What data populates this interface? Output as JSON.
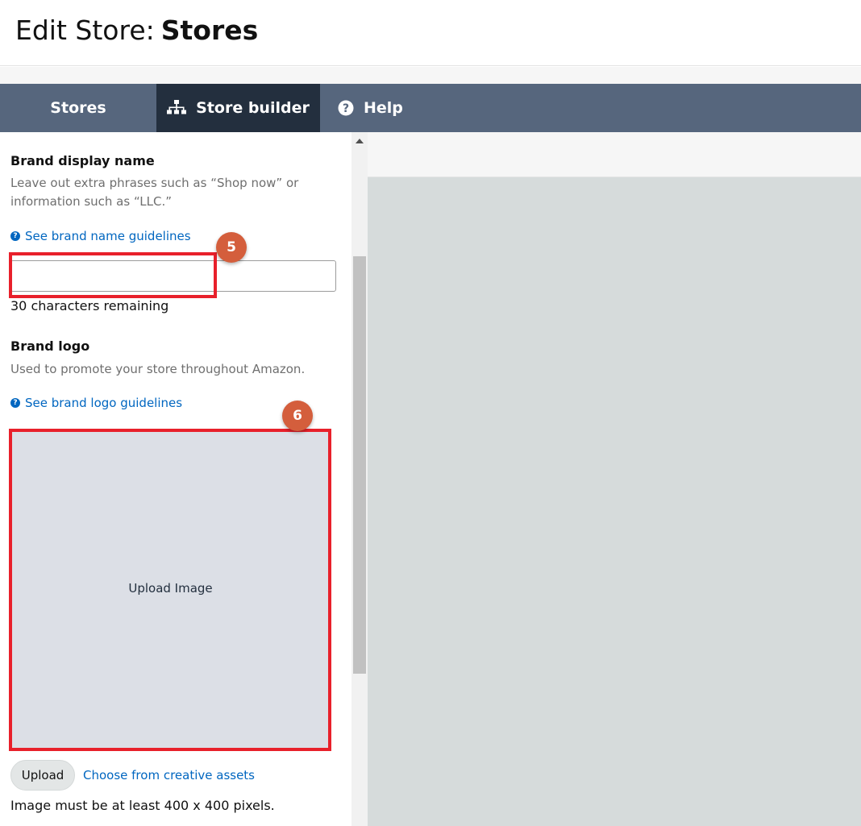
{
  "header": {
    "title_prefix": "Edit Store:",
    "title_store": "Stores"
  },
  "nav": {
    "tabs": [
      {
        "label": "Stores",
        "icon": null,
        "active": false
      },
      {
        "label": "Store builder",
        "icon": "sitemap-icon",
        "active": true
      },
      {
        "label": "Help",
        "icon": "question-circle-icon",
        "active": false
      }
    ]
  },
  "brand_name": {
    "heading": "Brand display name",
    "hint": "Leave out extra phrases such as “Shop now” or information such as “LLC.”",
    "guidelines_link": "See brand name guidelines",
    "input_value": "",
    "input_placeholder": "",
    "chars_remaining": "30 characters remaining"
  },
  "brand_logo": {
    "heading": "Brand logo",
    "hint": "Used to promote your store throughout Amazon.",
    "guidelines_link": "See brand logo guidelines",
    "upload_area_label": "Upload Image",
    "upload_button": "Upload",
    "choose_assets_link": "Choose from creative assets",
    "requirement": "Image must be at least 400 x 400 pixels."
  },
  "annotations": [
    {
      "label": "5",
      "target": "brand-name-input"
    },
    {
      "label": "6",
      "target": "logo-upload-area"
    }
  ],
  "colors": {
    "nav_bg": "#56667d",
    "nav_active": "#232f3e",
    "link": "#0066c0",
    "highlight": "#e8202b",
    "badge": "#d45e3c",
    "preview_canvas": "#d6dbdb"
  }
}
